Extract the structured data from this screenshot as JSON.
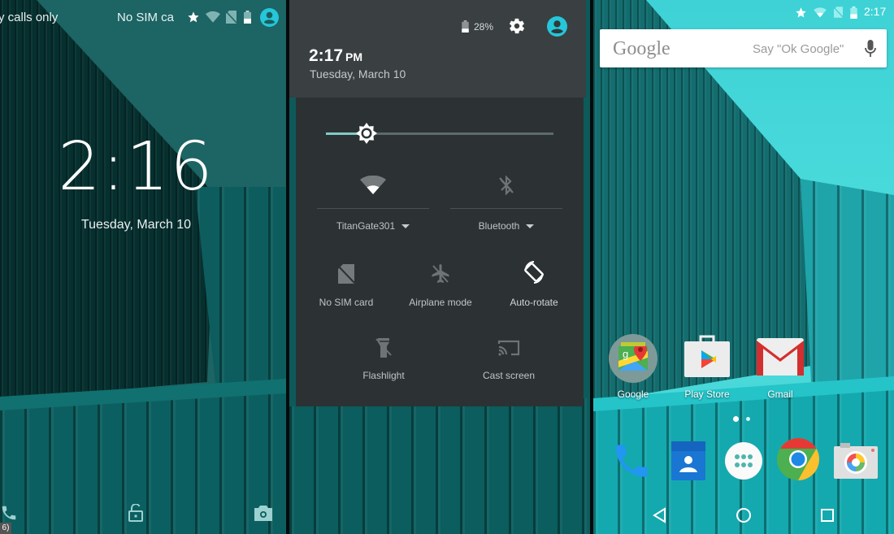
{
  "lock_screen": {
    "status_bar": {
      "carrier_text": "y calls only",
      "sim_text": "No SIM ca",
      "icons": [
        "star-icon",
        "wifi-icon",
        "no-sim-icon",
        "battery-icon",
        "user-avatar-icon"
      ]
    },
    "clock": {
      "hours": "2",
      "minutes": "16"
    },
    "date": "Tuesday, March 10",
    "bottom_icons": [
      "phone-icon",
      "lock-icon",
      "camera-icon"
    ],
    "corner_tag": "6)"
  },
  "quick_settings": {
    "battery_percent": "28%",
    "time": "2:17",
    "ampm": "PM",
    "date": "Tuesday, March 10",
    "brightness_fraction": 0.18,
    "tiles": [
      {
        "id": "wifi",
        "label": "TitanGate301",
        "icon": "wifi-icon",
        "active": true,
        "has_dropdown": true
      },
      {
        "id": "bluetooth",
        "label": "Bluetooth",
        "icon": "bluetooth-off-icon",
        "active": false,
        "has_dropdown": true
      },
      {
        "id": "sim",
        "label": "No SIM card",
        "icon": "no-sim-icon",
        "active": false
      },
      {
        "id": "airplane",
        "label": "Airplane mode",
        "icon": "airplane-off-icon",
        "active": false
      },
      {
        "id": "rotate",
        "label": "Auto-rotate",
        "icon": "auto-rotate-icon",
        "active": true
      },
      {
        "id": "flashlight",
        "label": "Flashlight",
        "icon": "flashlight-off-icon",
        "active": false
      },
      {
        "id": "cast",
        "label": "Cast screen",
        "icon": "cast-icon",
        "active": false
      }
    ]
  },
  "home_screen": {
    "status_bar": {
      "time": "2:17"
    },
    "search": {
      "logo": "Google",
      "hint": "Say \"Ok Google\""
    },
    "apps": [
      {
        "label": "Google",
        "icon": "google-folder-icon"
      },
      {
        "label": "Play Store",
        "icon": "play-store-icon"
      },
      {
        "label": "Gmail",
        "icon": "gmail-icon"
      }
    ],
    "page_indicator": {
      "pages": 2,
      "current": 1
    },
    "dock": [
      "phone-icon",
      "contacts-icon",
      "app-drawer-icon",
      "chrome-icon",
      "camera-icon"
    ],
    "nav": [
      "back-icon",
      "home-icon",
      "recents-icon"
    ]
  },
  "colors": {
    "accent_teal": "#26c6da",
    "shade_bg": "#2c3234",
    "shade_header": "#3a3f41",
    "slider_fill": "#80cbc4"
  }
}
